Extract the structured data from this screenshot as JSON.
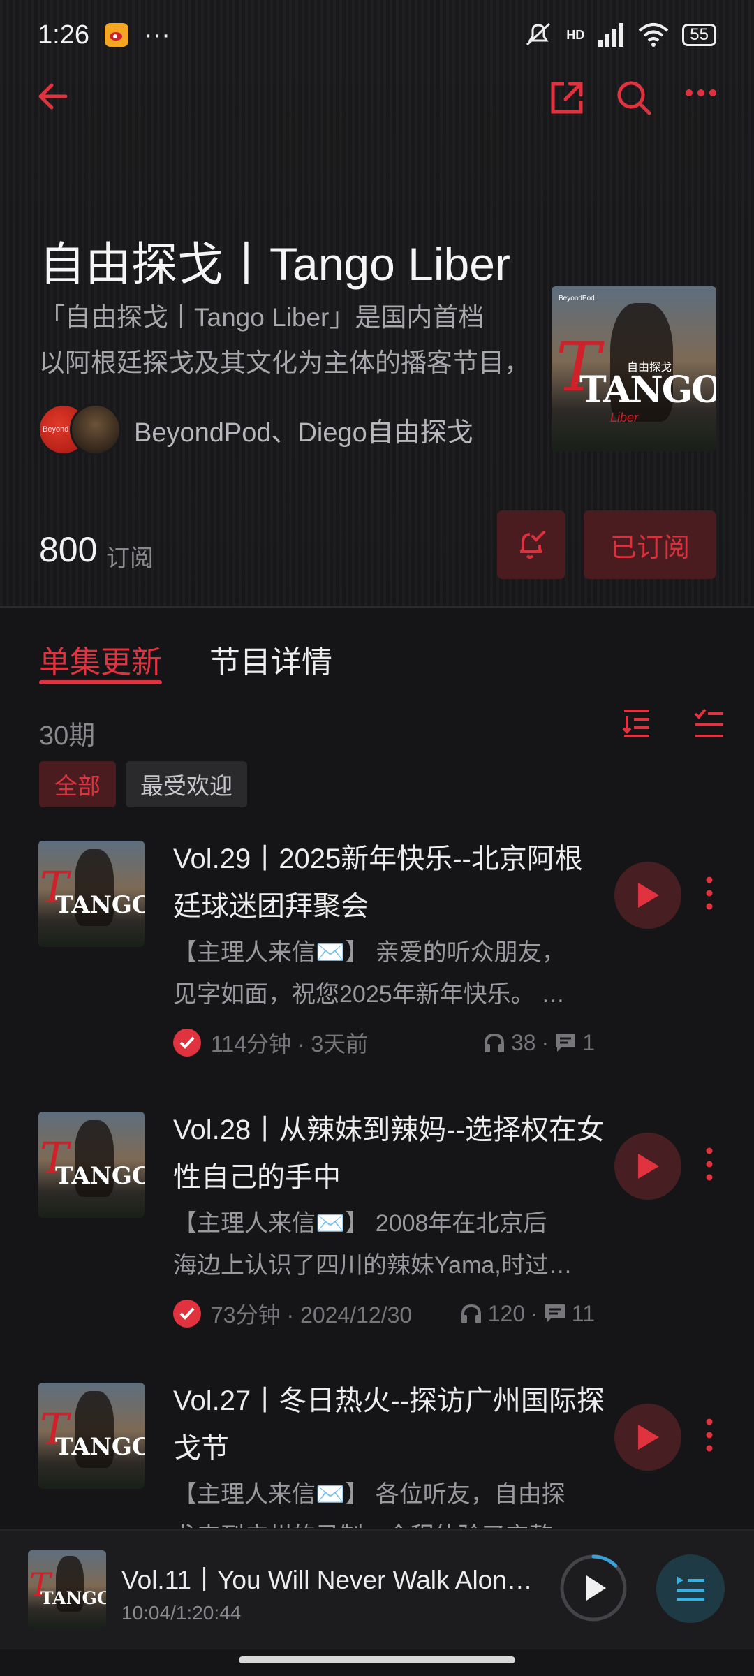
{
  "status": {
    "time": "1:26",
    "dots": "···",
    "network": "HD",
    "battery": "55"
  },
  "podcast": {
    "title": "自由探戈丨Tango Liber",
    "description_line1": "「自由探戈丨Tango Liber」是国内首档",
    "description_line2": "以阿根廷探戈及其文化为主体的播客节目，",
    "authors": "BeyondPod、Diego自由探戈",
    "avatar1_label": "Beyond Pod",
    "cover_word": "TANGO",
    "cover_subtitle": "自由探戈",
    "cover_sub2": "Liber",
    "cover_brand": "BeyondPod"
  },
  "subscription": {
    "count": "800",
    "label": "订阅",
    "button": "已订阅"
  },
  "tabs": [
    {
      "label": "单集更新"
    },
    {
      "label": "节目详情"
    }
  ],
  "list": {
    "count": "30期"
  },
  "filters": [
    {
      "label": "全部"
    },
    {
      "label": "最受欢迎"
    }
  ],
  "episodes": [
    {
      "title": "Vol.29丨2025新年快乐--北京阿根廷球迷团拜聚会",
      "desc1": "【主理人来信✉️】 亲爱的听众朋友，",
      "desc2": "见字如面，祝您2025年新年快乐。 …",
      "meta": "114分钟 · 3天前",
      "listens": "38",
      "comments": "1"
    },
    {
      "title": "Vol.28丨从辣妹到辣妈--选择权在女性自己的手中",
      "desc1": "【主理人来信✉️】 2008年在北京后",
      "desc2": "海边上认识了四川的辣妹Yama,时过境迁…",
      "meta": "73分钟 · 2024/12/30",
      "listens": "120",
      "comments": "11"
    },
    {
      "title": "Vol.27丨冬日热火--探访广州国际探戈节",
      "desc1": "【主理人来信✉️】 各位听友，自由探",
      "desc2": "戈来到广州的录制，全程体验了完整的…",
      "meta": "",
      "listens": "",
      "comments": ""
    }
  ],
  "player": {
    "title": "Vol.11丨You Will Never Walk Alone …",
    "time": "10:04/1:20:44",
    "progress": 0.125
  },
  "colors": {
    "accent": "#e0333f",
    "background": "#151517"
  }
}
